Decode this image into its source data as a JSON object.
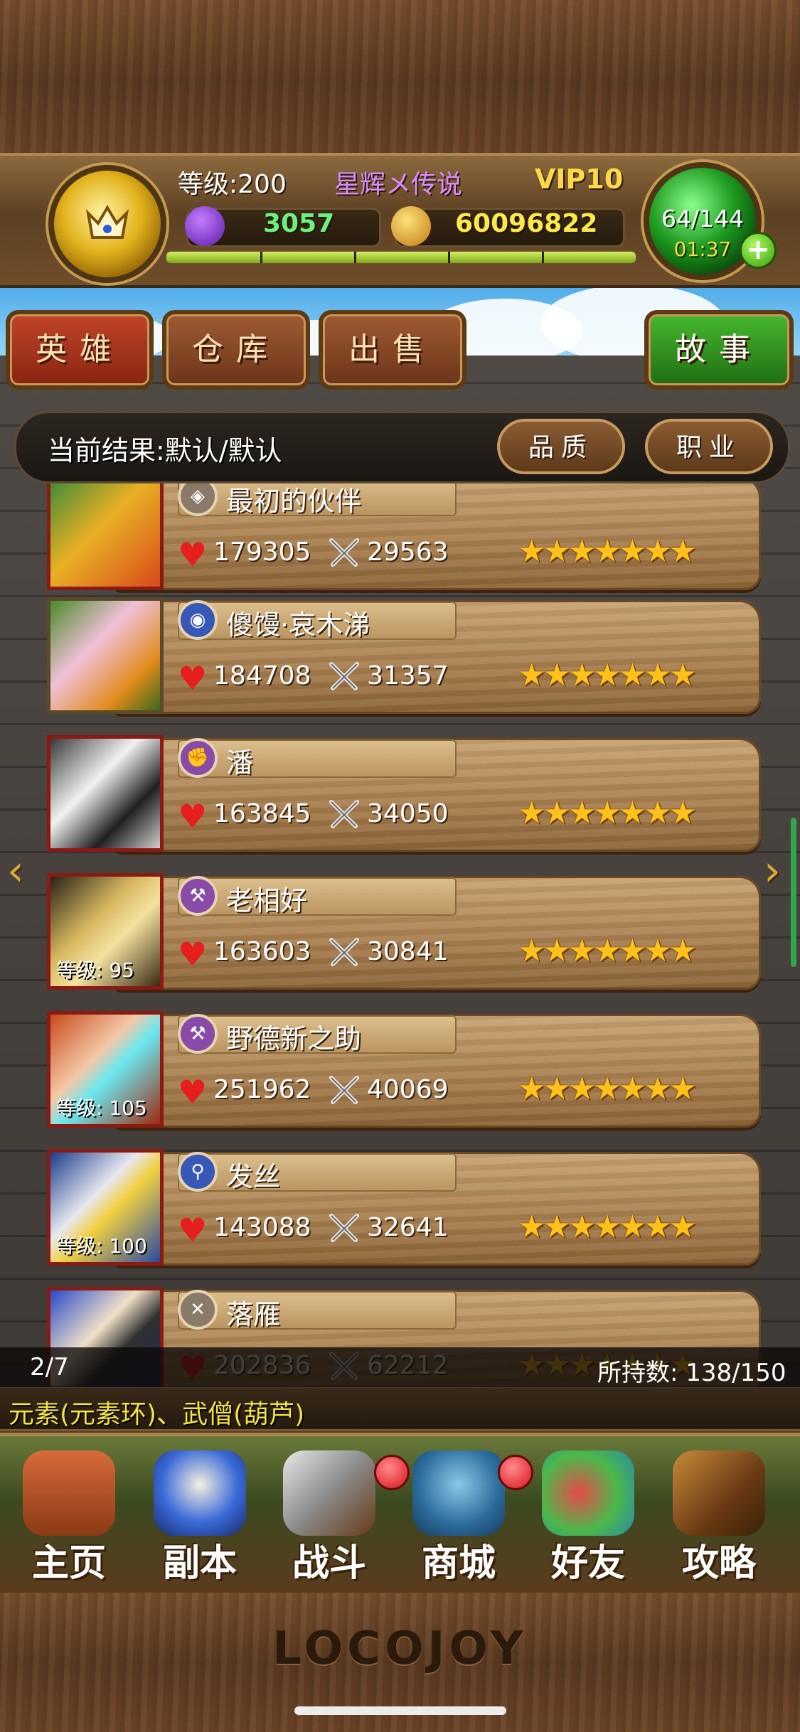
{
  "header": {
    "level": "等级:200",
    "player_name": "星辉メ传说",
    "vip": "VIP10",
    "gems": "3057",
    "gold": "60096822",
    "energy": "64/144",
    "timer": "01:37",
    "add_energy": "+"
  },
  "tabs": [
    {
      "label": "英雄"
    },
    {
      "label": "仓库"
    },
    {
      "label": "出售"
    },
    {
      "label": "故事"
    }
  ],
  "filter": {
    "label": "当前结果:默认/默认",
    "quality": "品质",
    "job": "职业"
  },
  "heroes": [
    {
      "name": "最初的伙伴",
      "hp": "179305",
      "atk": "29563",
      "stars": "★★★★★★★",
      "level": "",
      "class_icon": "shield-icon",
      "class_color": "#8a7a6a"
    },
    {
      "name": "傻馒·哀木涕",
      "hp": "184708",
      "atk": "31357",
      "stars": "★★★★★★★",
      "level": "",
      "class_icon": "helmet-icon",
      "class_color": "#3858b8"
    },
    {
      "name": "潘",
      "hp": "163845",
      "atk": "34050",
      "stars": "★★★★★★★",
      "level": "",
      "class_icon": "fist-icon",
      "class_color": "#8a4aa8"
    },
    {
      "name": "老相好",
      "hp": "163603",
      "atk": "30841",
      "stars": "★★★★★★★",
      "level": "等级: 95",
      "class_icon": "hammer-icon",
      "class_color": "#8a4aa8"
    },
    {
      "name": "野德新之助",
      "hp": "251962",
      "atk": "40069",
      "stars": "★★★★★★★",
      "level": "等级: 105",
      "class_icon": "hammer-icon",
      "class_color": "#8a4aa8"
    },
    {
      "name": "发丝",
      "hp": "143088",
      "atk": "32641",
      "stars": "★★★★★★★",
      "level": "等级: 100",
      "class_icon": "staff-icon",
      "class_color": "#3858b8"
    },
    {
      "name": "落雁",
      "hp": "202836",
      "atk": "62212",
      "stars": "★★★★★★★",
      "level": "",
      "class_icon": "bow-icon",
      "class_color": "#8a7a6a"
    }
  ],
  "list_footer": {
    "page": "2/7",
    "hold_count": "所持数: 138/150",
    "hint": "元素(元素环)、武僧(葫芦)"
  },
  "nav": [
    {
      "label": "主页",
      "icon": "house-icon"
    },
    {
      "label": "副本",
      "icon": "skull-icon"
    },
    {
      "label": "战斗",
      "icon": "sword-icon"
    },
    {
      "label": "商城",
      "icon": "shop-icon"
    },
    {
      "label": "好友",
      "icon": "friends-icon"
    },
    {
      "label": "攻略",
      "icon": "book-icon"
    }
  ],
  "logo": "LOCOJOY",
  "colors": {
    "tab_red": "#8a2410",
    "tab_green": "#1f6e12",
    "star": "#ffc21a",
    "hint_yellow": "#f5e33a",
    "vip_gold": "#ffd84a",
    "name_purple": "#d98bff"
  }
}
